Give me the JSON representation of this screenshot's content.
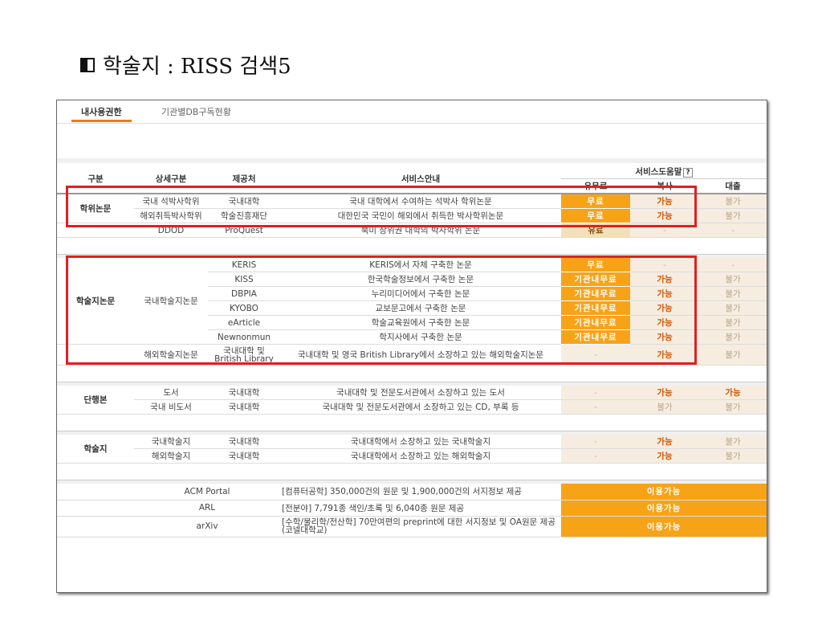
{
  "slide": {
    "title": "학술지 : RISS 검색5"
  },
  "tabs": {
    "active": "내사용권한",
    "other": "기관별DB구독현황"
  },
  "header": {
    "col1": "구분",
    "col2": "상세구분",
    "col3": "제공처",
    "col4": "서비스안내",
    "service_help": "서비스도움말",
    "help_mark": "?",
    "fee": "유무료",
    "copy": "복사",
    "loan": "대출"
  },
  "thesis": {
    "category": "학위논문",
    "rows": [
      {
        "sub": "국내 석박사학위",
        "provider": "국내대학",
        "desc": "국내 대학에서 수여하는 석박사 학위논문",
        "fee": "무료",
        "copy": "가능",
        "loan": "불가"
      },
      {
        "sub": "해외취득박사학위",
        "provider": "학술진흥재단",
        "desc": "대한민국 국민이 해외에서 취득한 박사학위논문",
        "fee": "무료",
        "copy": "가능",
        "loan": "불가"
      },
      {
        "sub": "DDOD",
        "provider": "ProQuest",
        "desc": "북미 상위권 대학의 박사학위 논문",
        "fee": "유료",
        "copy": "-",
        "loan": "-"
      }
    ]
  },
  "journal_paper": {
    "category": "학술지논문",
    "sub_domestic": "국내학술지논문",
    "rows": [
      {
        "provider": "KERIS",
        "desc": "KERIS에서 자체 구축한 논문",
        "fee": "무료",
        "copy": "-",
        "loan": "-"
      },
      {
        "provider": "KISS",
        "desc": "한국학술정보에서 구축한 논문",
        "fee": "기관내무료",
        "copy": "가능",
        "loan": "불가"
      },
      {
        "provider": "DBPIA",
        "desc": "누리미디어에서 구축한 논문",
        "fee": "기관내무료",
        "copy": "가능",
        "loan": "불가"
      },
      {
        "provider": "KYOBO",
        "desc": "교보문고에서 구축한 논문",
        "fee": "기관내무료",
        "copy": "가능",
        "loan": "불가"
      },
      {
        "provider": "eArticle",
        "desc": "학술교육원에서 구축한 논문",
        "fee": "기관내무료",
        "copy": "가능",
        "loan": "불가"
      },
      {
        "provider": "Newnonmun",
        "desc": "학지사에서 구축한 논문",
        "fee": "기관내무료",
        "copy": "가능",
        "loan": "불가"
      }
    ],
    "foreign": {
      "sub": "해외학술지논문",
      "provider": "국내대학 및 British Library",
      "desc": "국내대학 및 영국 British Library에서 소장하고 있는 해외학술지논문",
      "fee": "-",
      "copy": "가능",
      "loan": "불가"
    }
  },
  "books": {
    "category": "단행본",
    "rows": [
      {
        "sub": "도서",
        "provider": "국내대학",
        "desc": "국내대학 및 전문도서관에서 소장하고 있는 도서",
        "fee": "-",
        "copy": "가능",
        "loan": "가능"
      },
      {
        "sub": "국내 비도서",
        "provider": "국내대학",
        "desc": "국내대학 및 전문도서관에서 소장하고 있는 CD, 부록 등",
        "fee": "-",
        "copy": "불가",
        "loan": "불가"
      }
    ]
  },
  "journals": {
    "category": "학술지",
    "rows": [
      {
        "sub": "국내학술지",
        "provider": "국내대학",
        "desc": "국내대학에서 소장하고 있는 국내학술지",
        "fee": "-",
        "copy": "가능",
        "loan": "불가"
      },
      {
        "sub": "해외학술지",
        "provider": "국내대학",
        "desc": "국내대학에서 소장하고 있는 해외학술지",
        "fee": "-",
        "copy": "가능",
        "loan": "불가"
      }
    ]
  },
  "external": [
    {
      "name": "ACM Portal",
      "desc": "[컴퓨터공학] 350,000건의 원문 및 1,900,000건의 서지정보 제공",
      "status": "이용가능"
    },
    {
      "name": "ARL",
      "desc": "[전분야] 7,791종 색인/초록 및 6,040종 원문 제공",
      "status": "이용가능"
    },
    {
      "name": "arXiv",
      "desc": "[수학/물리학/전산학] 70만여편의 preprint에 대한 서지정보 및 OA원문 제공 (코넬대학교)",
      "status": "이용가능"
    }
  ],
  "colors": {
    "accent": "#f7a318",
    "highlight_box": "#e02020"
  }
}
